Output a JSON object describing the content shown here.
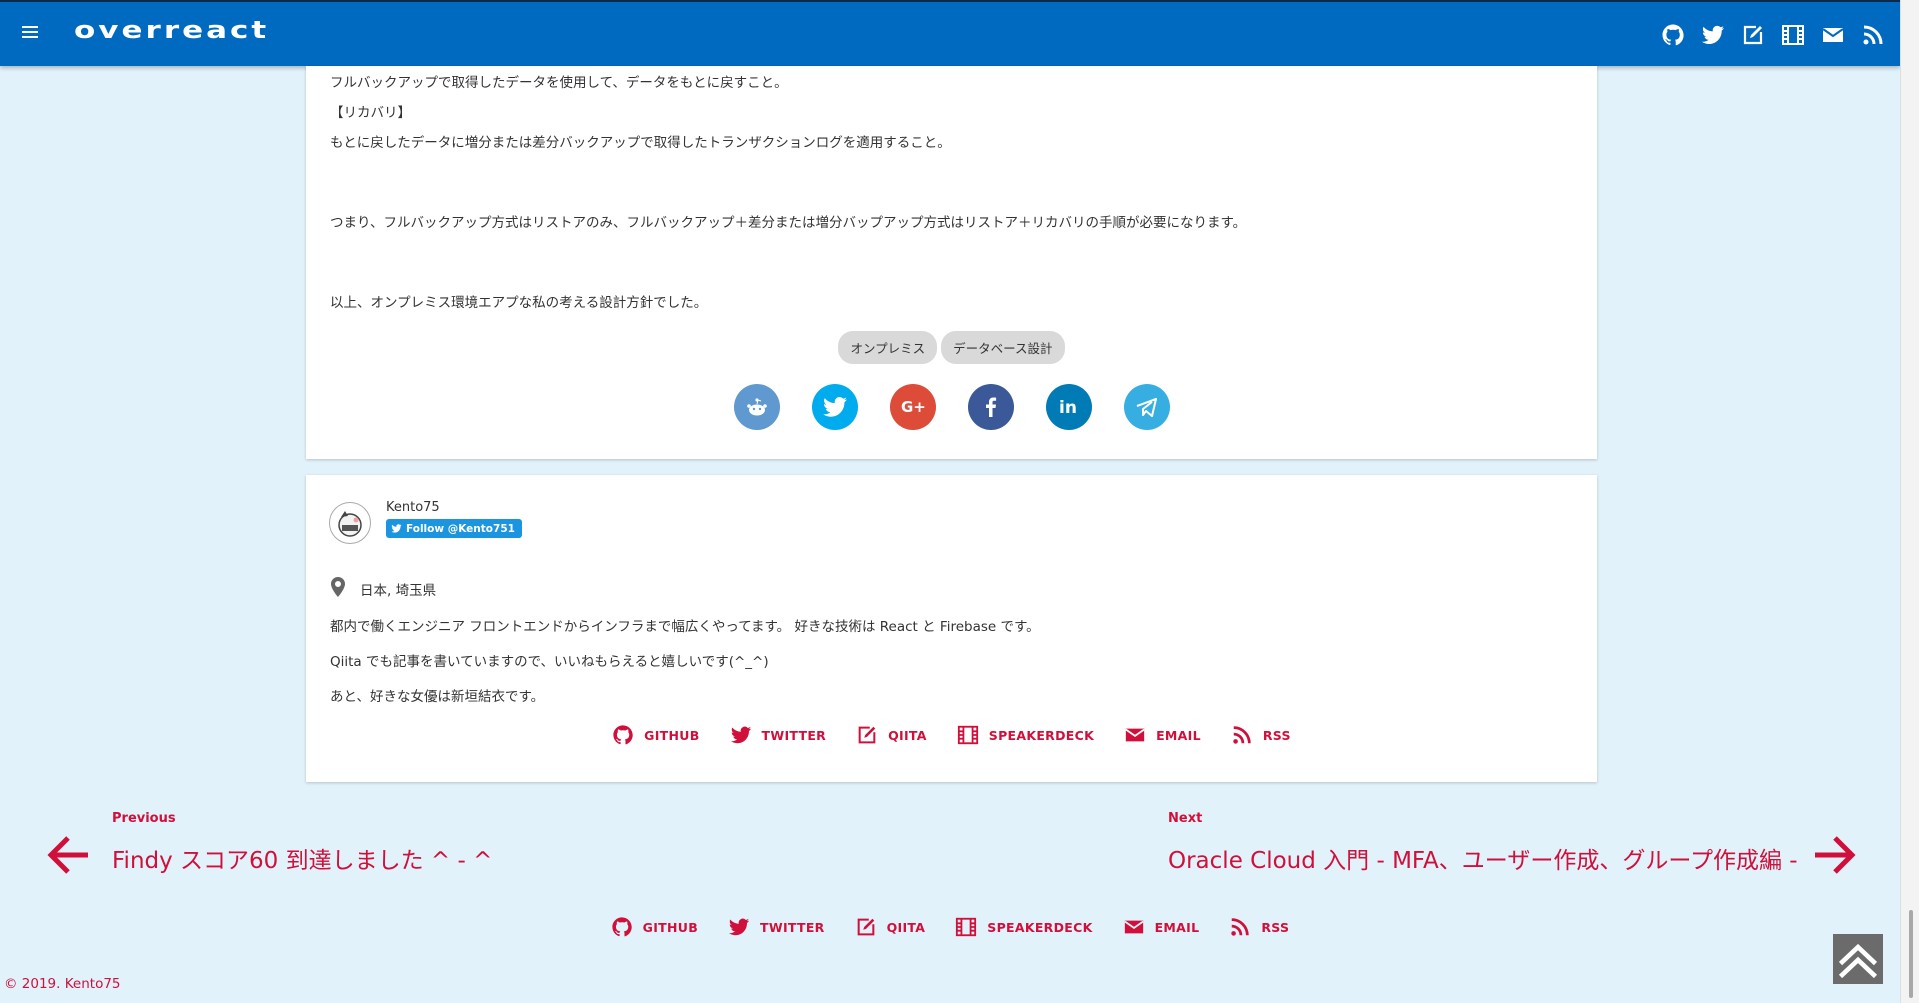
{
  "header": {
    "logo": "overreact",
    "icons": [
      "github-icon",
      "twitter-icon",
      "edit-icon",
      "film-icon",
      "email-icon",
      "rss-icon"
    ],
    "color": "#0069c0"
  },
  "article": {
    "paragraphs": [
      "フルバックアップで取得したデータを使用して、データをもとに戻すこと。",
      "【リカバリ】",
      "もとに戻したデータに増分または差分バックアップで取得したトランザクションログを適用すること。",
      "つまり、フルバックアップ方式はリストアのみ、フルバックアップ＋差分または増分バップアップ方式はリストア＋リカバリの手順が必要になります。",
      "以上、オンプレミス環境エアプな私の考える設計方針でした。"
    ],
    "tags": [
      "オンプレミス",
      "データベース設計"
    ],
    "share_buttons": [
      {
        "name": "reddit",
        "color": "#5f99cf"
      },
      {
        "name": "twitter",
        "color": "#00aced"
      },
      {
        "name": "google-plus",
        "color": "#dd4b39"
      },
      {
        "name": "facebook",
        "color": "#3b5998"
      },
      {
        "name": "linkedin",
        "color": "#007bb6"
      },
      {
        "name": "telegram",
        "color": "#37aee2"
      }
    ]
  },
  "profile": {
    "name": "Kento75",
    "follow_label": "Follow @Kento751",
    "location": "日本, 埼玉県",
    "bio": [
      "都内で働くエンジニア フロントエンドからインフラまで幅広くやってます。 好きな技術は React と Firebase です。",
      "Qiita でも記事を書いていますので、いいねもらえると嬉しいです(^_^)",
      "あと、好きな女優は新垣結衣です。"
    ]
  },
  "social_links": [
    "GITHUB",
    "TWITTER",
    "QIITA",
    "SPEAKERDECK",
    "EMAIL",
    "RSS"
  ],
  "pagination": {
    "previous_label": "Previous",
    "previous_title": "Findy スコア60 到達しました ^ - ^",
    "next_label": "Next",
    "next_title": "Oracle Cloud 入門 - MFA、ユーザー作成、グループ作成編 -"
  },
  "footer": {
    "copyright": "© 2019. Kento75"
  },
  "colors": {
    "accent": "#d0103a",
    "background": "#e1f2fb"
  }
}
